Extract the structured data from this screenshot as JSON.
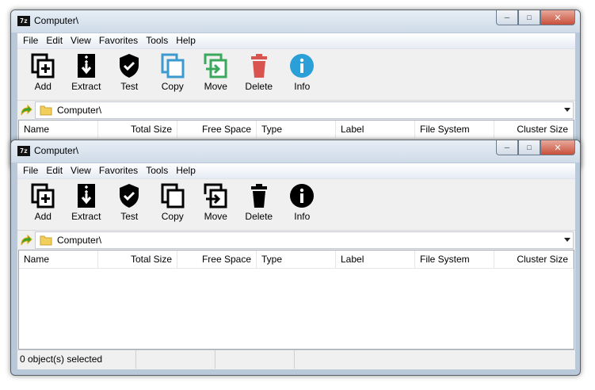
{
  "windows": [
    {
      "title": "Computer\\",
      "app_icon_text": "7z",
      "menu": [
        "File",
        "Edit",
        "View",
        "Favorites",
        "Tools",
        "Help"
      ],
      "toolbar": [
        {
          "label": "Add",
          "icon": "add-icon",
          "color": "#000000"
        },
        {
          "label": "Extract",
          "icon": "extract-icon",
          "color": "#000000"
        },
        {
          "label": "Test",
          "icon": "shield-check-icon",
          "color": "#000000"
        },
        {
          "label": "Copy",
          "icon": "copy-icon",
          "color": "#3d9ad1"
        },
        {
          "label": "Move",
          "icon": "move-icon",
          "color": "#3aa95b"
        },
        {
          "label": "Delete",
          "icon": "trash-icon",
          "color": "#d9534f"
        },
        {
          "label": "Info",
          "icon": "info-icon",
          "color": "#2a9fd8"
        }
      ],
      "address": "Computer\\",
      "columns": [
        "Name",
        "Total Size",
        "Free Space",
        "Type",
        "Label",
        "File System",
        "Cluster Size"
      ]
    },
    {
      "title": "Computer\\",
      "app_icon_text": "7z",
      "menu": [
        "File",
        "Edit",
        "View",
        "Favorites",
        "Tools",
        "Help"
      ],
      "toolbar": [
        {
          "label": "Add",
          "icon": "add-icon",
          "color": "#000000"
        },
        {
          "label": "Extract",
          "icon": "extract-icon",
          "color": "#000000"
        },
        {
          "label": "Test",
          "icon": "shield-check-icon",
          "color": "#000000"
        },
        {
          "label": "Copy",
          "icon": "copy-icon",
          "color": "#000000"
        },
        {
          "label": "Move",
          "icon": "move-icon",
          "color": "#000000"
        },
        {
          "label": "Delete",
          "icon": "trash-icon",
          "color": "#000000"
        },
        {
          "label": "Info",
          "icon": "info-icon",
          "color": "#000000"
        }
      ],
      "address": "Computer\\",
      "columns": [
        "Name",
        "Total Size",
        "Free Space",
        "Type",
        "Label",
        "File System",
        "Cluster Size"
      ],
      "status": [
        "0 object(s) selected",
        "",
        "",
        ""
      ]
    }
  ]
}
